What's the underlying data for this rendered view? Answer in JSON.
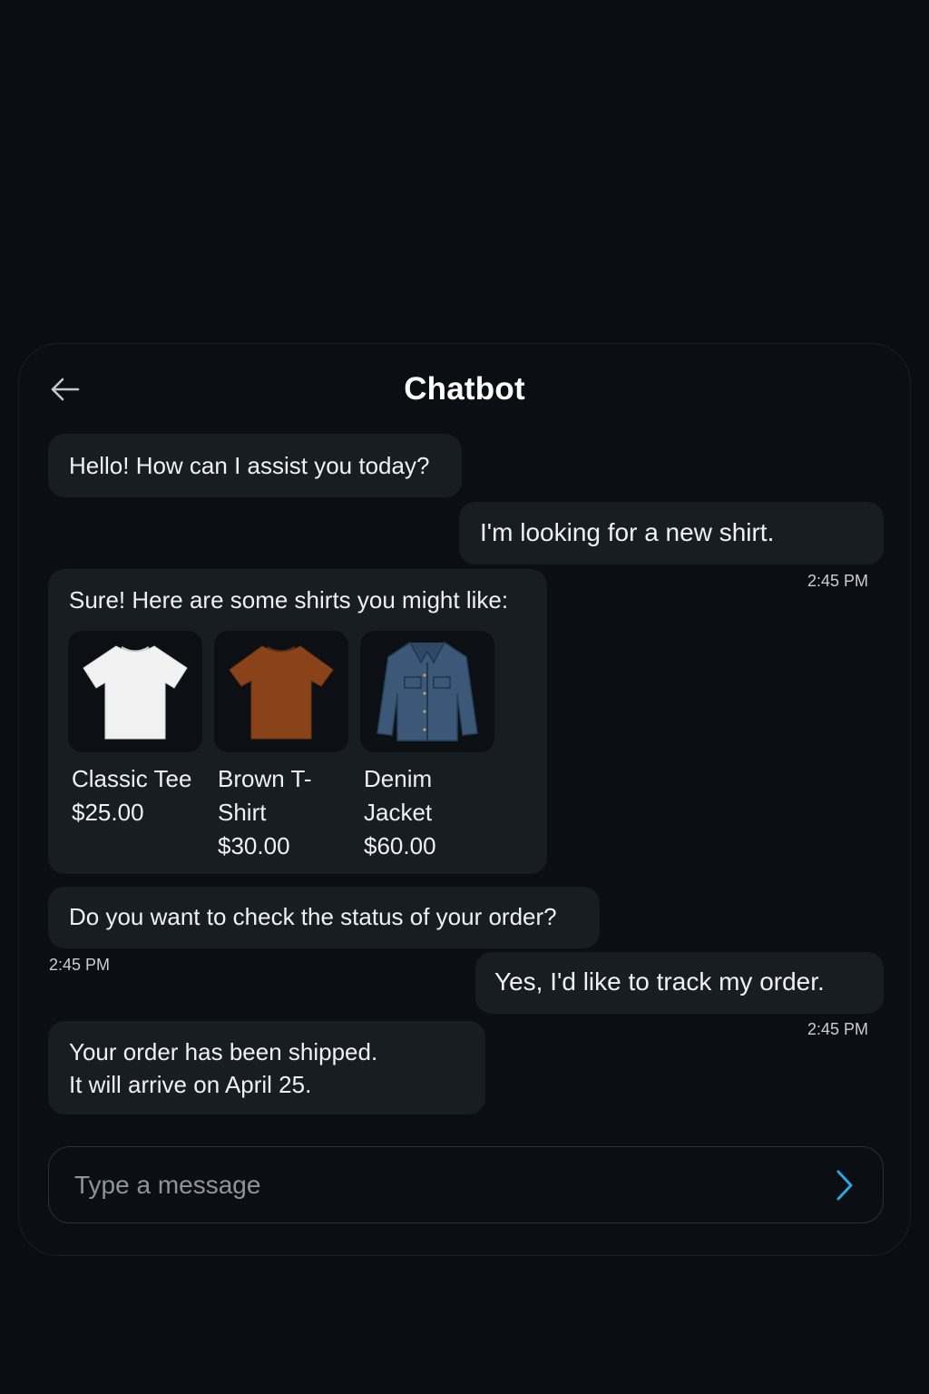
{
  "header": {
    "title": "Chatbot",
    "back_icon": "arrow-left-icon"
  },
  "messages": [
    {
      "sender": "bot",
      "text": "Hello! How can I assist you today?"
    },
    {
      "sender": "user",
      "text": "I'm looking for a new shirt.",
      "time": "2:45 PM"
    },
    {
      "sender": "bot",
      "text": "Sure! Here are some shirts you might like:",
      "products": [
        {
          "name": "Classic Tee",
          "price": "$25.00",
          "icon": "white-tshirt-icon",
          "color": "#f2f2f2"
        },
        {
          "name": "Brown T-Shirt",
          "price": "$30.00",
          "icon": "brown-tshirt-icon",
          "color": "#8a4318"
        },
        {
          "name": "Denim Jacket",
          "price": "$60.00",
          "icon": "denim-jacket-icon",
          "color": "#3b5878"
        }
      ]
    },
    {
      "sender": "bot",
      "text": "Do you want to check the status of your order?",
      "time": "2:45 PM"
    },
    {
      "sender": "user",
      "text": "Yes, I'd like to track my order.",
      "time": "2:45 PM"
    },
    {
      "sender": "bot",
      "lines": [
        "Your order has been shipped.",
        "It will arrive on April 25."
      ]
    }
  ],
  "composer": {
    "placeholder": "Type a message",
    "send_icon": "chevron-right-icon",
    "accent": "#29a8e0"
  }
}
